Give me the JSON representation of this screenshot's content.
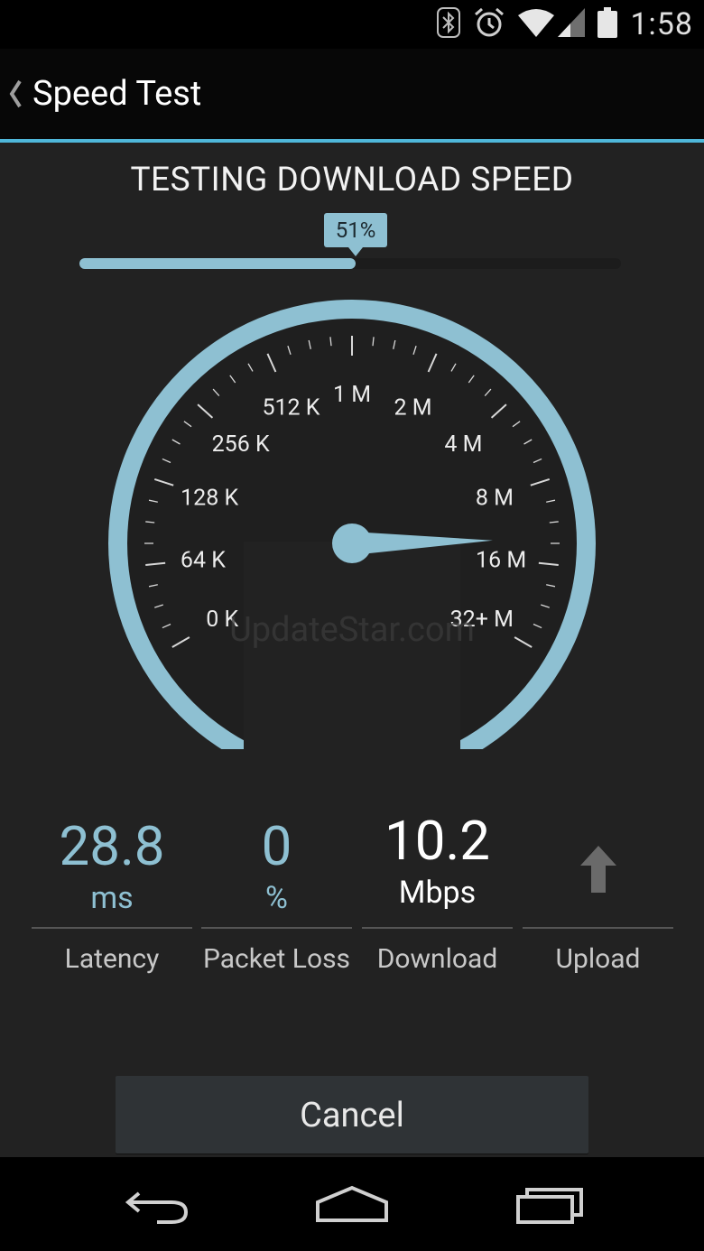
{
  "status_bar": {
    "time": "1:58",
    "icons": [
      "bluetooth-icon",
      "alarm-icon",
      "wifi-icon",
      "signal-icon",
      "battery-icon"
    ]
  },
  "action_bar": {
    "title": "Speed Test",
    "back_icon": "chevron-left-icon"
  },
  "test": {
    "heading": "TESTING DOWNLOAD SPEED",
    "progress_percent": 51,
    "progress_label": "51%"
  },
  "gauge": {
    "labels": [
      "0 K",
      "64 K",
      "128 K",
      "256 K",
      "512 K",
      "1 M",
      "2 M",
      "4 M",
      "8 M",
      "16 M",
      "32+ M"
    ],
    "needle_position": 8.7,
    "colors": {
      "arc": "#8ec0d2",
      "face": "#1f1f1f"
    },
    "watermark": "UpdateStar.com"
  },
  "stats": {
    "latency": {
      "value": "28.8",
      "unit": "ms",
      "label": "Latency"
    },
    "packet_loss": {
      "value": "0",
      "unit": "%",
      "label": "Packet Loss"
    },
    "download": {
      "value": "10.2",
      "unit": "Mbps",
      "label": "Download"
    },
    "upload": {
      "icon": "arrow-up-icon",
      "label": "Upload"
    }
  },
  "actions": {
    "cancel_label": "Cancel"
  },
  "nav_bar": {
    "icons": [
      "back-icon",
      "home-icon",
      "recents-icon"
    ]
  },
  "colors": {
    "accent": "#4fb7da",
    "gauge_blue": "#8ec0d2",
    "background": "#222222"
  }
}
